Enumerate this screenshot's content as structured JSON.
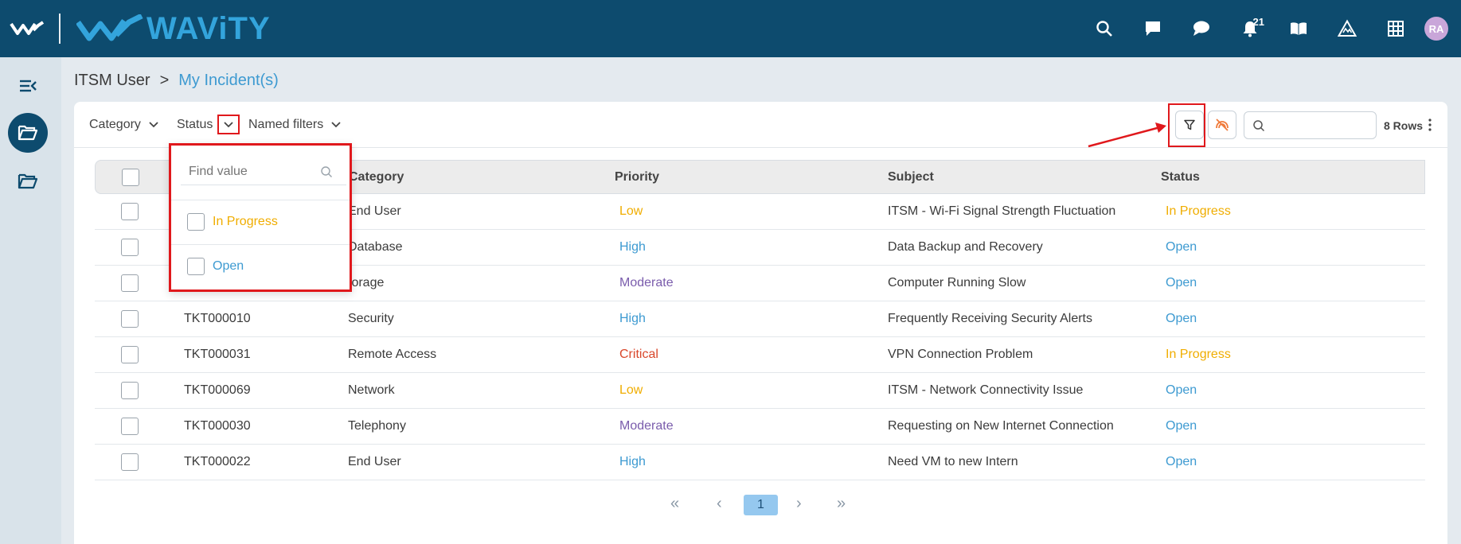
{
  "header": {
    "logo_text": "WAViTY",
    "icons": [
      "search-icon",
      "chat-square-icon",
      "chat-bubble-icon",
      "bell-icon",
      "book-icon",
      "triangle-icon",
      "grid-icon"
    ],
    "notification_count": "21",
    "avatar_initials": "RA"
  },
  "sidebar": {
    "items": [
      "menu-collapse-icon",
      "folder-open-icon",
      "folder-icon"
    ]
  },
  "breadcrumb": {
    "root": "ITSM User",
    "separator": ">",
    "current": "My Incident(s)"
  },
  "toolbar": {
    "category_label": "Category",
    "status_label": "Status",
    "named_filters_label": "Named filters",
    "search_placeholder": "",
    "rows_label": "8 Rows"
  },
  "table": {
    "columns": [
      "",
      "Category",
      "Priority",
      "Subject",
      "Status"
    ],
    "rows": [
      {
        "id": "",
        "category": "End User",
        "priority": "Low",
        "subject": "ITSM - Wi-Fi Signal Strength Fluctuation",
        "status": "In Progress"
      },
      {
        "id": "",
        "category": "Database",
        "priority": "High",
        "subject": "Data Backup and Recovery",
        "status": "Open"
      },
      {
        "id": "",
        "category": "torage",
        "priority": "Moderate",
        "subject": "Computer Running Slow",
        "status": "Open"
      },
      {
        "id": "TKT000010",
        "category": "Security",
        "priority": "High",
        "subject": "Frequently Receiving Security Alerts",
        "status": "Open"
      },
      {
        "id": "TKT000031",
        "category": "Remote Access",
        "priority": "Critical",
        "subject": "VPN Connection Problem",
        "status": "In Progress"
      },
      {
        "id": "TKT000069",
        "category": "Network",
        "priority": "Low",
        "subject": "ITSM - Network Connectivity Issue",
        "status": "Open"
      },
      {
        "id": "TKT000030",
        "category": "Telephony",
        "priority": "Moderate",
        "subject": "Requesting on New Internet Connection",
        "status": "Open"
      },
      {
        "id": "TKT000022",
        "category": "End User",
        "priority": "High",
        "subject": "Need VM to new Intern",
        "status": "Open"
      }
    ]
  },
  "colors": {
    "Low": "#f0ad00",
    "High": "#3d9ad1",
    "Moderate": "#7a5cac",
    "Critical": "#d9472b",
    "In Progress": "#f0ad00",
    "Open": "#3d9ad1"
  },
  "pagination": {
    "first": "«",
    "prev": "‹",
    "current": "1",
    "next": "›",
    "last": "»"
  },
  "status_dropdown": {
    "search_placeholder": "Find value",
    "options": [
      "In Progress",
      "Open"
    ]
  }
}
